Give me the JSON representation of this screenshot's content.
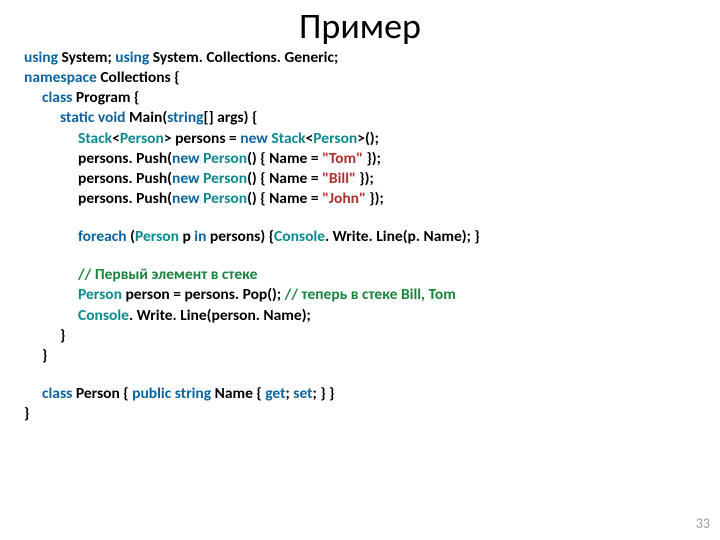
{
  "title": "Пример",
  "pagenum": "33",
  "t": {
    "using": "using",
    "namespace": "namespace",
    "class": "class",
    "static": "static",
    "void": "void",
    "string_arr": "string",
    "new": "new",
    "foreach": "foreach",
    "in": "in",
    "public": "public",
    "string": "string",
    "get": "get",
    "set": "set"
  },
  "s": {
    "System": "System; ",
    "SystemCG": "System. Collections. Generic;",
    "Collections": "Collections {",
    "Program": "Program {",
    "Main": "Main(",
    "args": "[] args) {",
    "decl_pre": "<",
    "decl_mid": "> persons = ",
    "decl_post": "<",
    "decl_end": ">();",
    "Stack": "Stack",
    "Person": "Person",
    "push_pre": "persons. Push(",
    "push_mid": "() { Name = ",
    "push_end": " });",
    "tom": "\"Tom\"",
    "bill": "\"Bill\"",
    "john": "\"John\"",
    "foreach_open": "(",
    "foreach_p": " p ",
    "foreach_close": "persons) {",
    "foreach_body": ". Write. Line(p. Name); }",
    "Console": "Console",
    "comment1": "// Первый элемент в стеке",
    "pop_pre": " person = persons. Pop(); ",
    "comment2": "// теперь в стеке Bill, Tom",
    "write_pre": ". Write. Line(person. Name);",
    "brace": "}",
    "personcls_pre": " { ",
    "personcls_mid": "Name { ",
    "personcls_semi": "; ",
    "personcls_end": "; } }",
    "space": " "
  }
}
